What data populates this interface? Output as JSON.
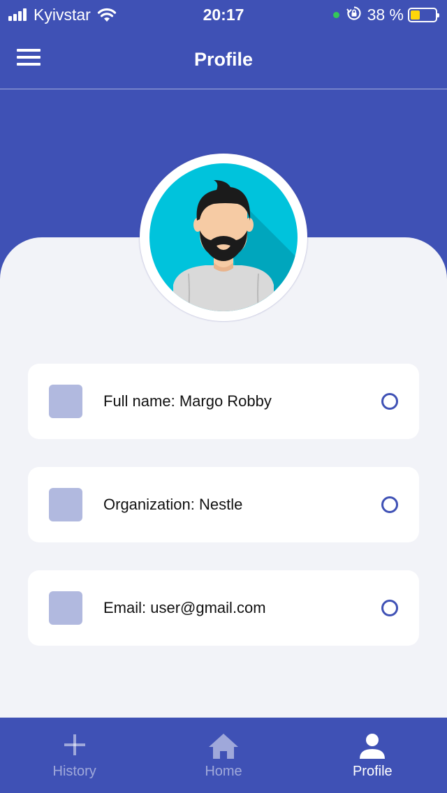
{
  "status_bar": {
    "carrier": "Kyivstar",
    "time": "20:17",
    "battery_percent": "38 %",
    "battery_level": 0.38,
    "icons": [
      "signal-icon",
      "wifi-icon",
      "green-dot-icon",
      "rotation-lock-icon",
      "battery-icon"
    ]
  },
  "app_bar": {
    "title": "Profile",
    "menu_icon": "hamburger-menu-icon"
  },
  "profile": {
    "avatar": "bearded-man-avatar"
  },
  "info_rows": [
    {
      "label": "Full name: Margo Robby"
    },
    {
      "label": "Organization: Nestle"
    },
    {
      "label": "Email: user@gmail.com"
    }
  ],
  "bottom_nav": {
    "items": [
      {
        "label": "History",
        "icon": "plus-icon",
        "active": false
      },
      {
        "label": "Home",
        "icon": "home-icon",
        "active": false
      },
      {
        "label": "Profile",
        "icon": "person-icon",
        "active": true
      }
    ]
  },
  "colors": {
    "primary": "#3f51b5",
    "background": "#f2f3f8",
    "card": "#ffffff",
    "accent_square": "#b1b9df",
    "battery_fill": "#ffd60a",
    "status_green": "#34c759"
  }
}
